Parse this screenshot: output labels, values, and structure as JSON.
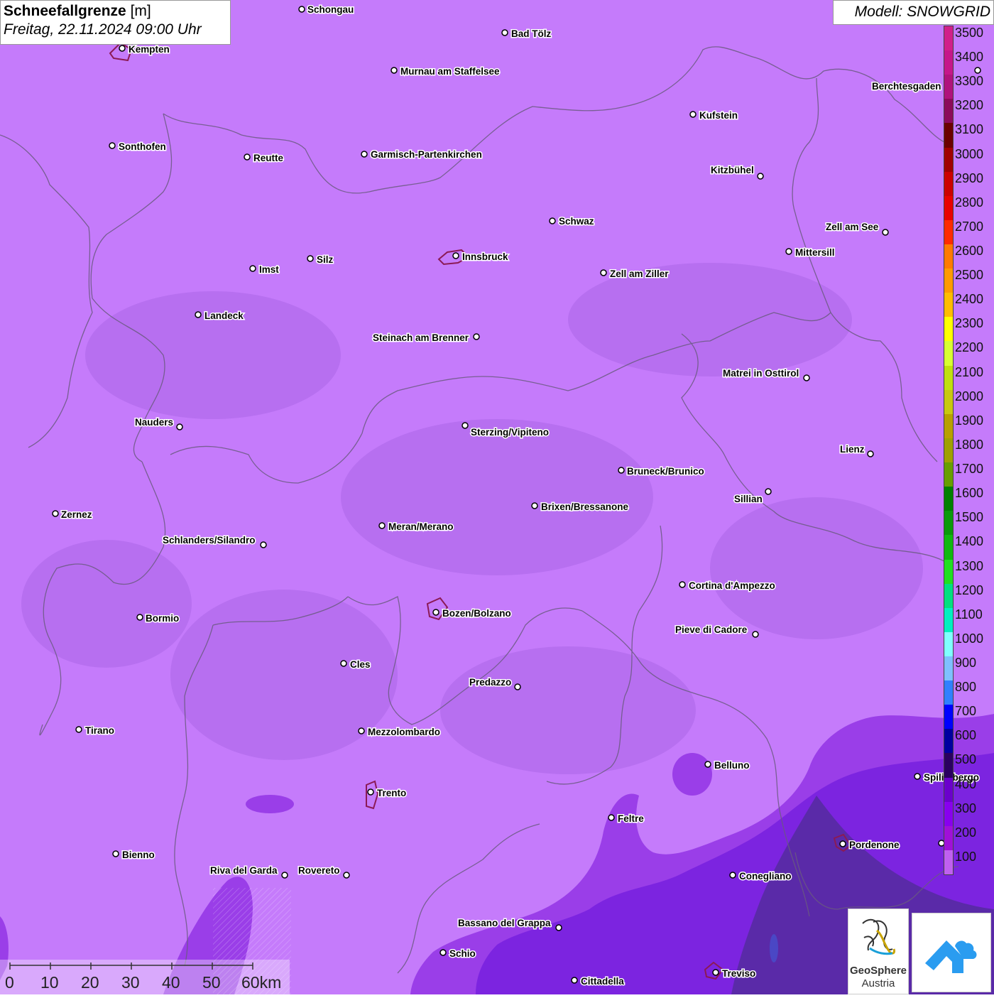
{
  "header": {
    "title": "Schneefallgrenze",
    "unit": "[m]",
    "datetime": "Freitag, 22.11.2024 09:00 Uhr"
  },
  "model": {
    "label": "Modell: SNOWGRID"
  },
  "colors": {
    "background": "#c57bfb",
    "low_band_300_400": "#9a3ee8",
    "low_band_100_200": "#7c24e0",
    "dark_band": "#5a2aa8",
    "boundary": "#6a5a80",
    "city_outline": "#8b1a55"
  },
  "legend": {
    "levels": [
      {
        "label": "3500",
        "color": "#d11f8a"
      },
      {
        "label": "3400",
        "color": "#c6168a"
      },
      {
        "label": "3300",
        "color": "#b0127c"
      },
      {
        "label": "3200",
        "color": "#8c0a5a"
      },
      {
        "label": "3100",
        "color": "#6b0000"
      },
      {
        "label": "3000",
        "color": "#a00000"
      },
      {
        "label": "2900",
        "color": "#cc0000"
      },
      {
        "label": "2800",
        "color": "#e80000"
      },
      {
        "label": "2700",
        "color": "#ff2a00"
      },
      {
        "label": "2600",
        "color": "#ff7a00"
      },
      {
        "label": "2500",
        "color": "#ff9a00"
      },
      {
        "label": "2400",
        "color": "#ffbc00"
      },
      {
        "label": "2300",
        "color": "#ffff00"
      },
      {
        "label": "2200",
        "color": "#d8ff33"
      },
      {
        "label": "2100",
        "color": "#c0e010"
      },
      {
        "label": "2000",
        "color": "#c8c810"
      },
      {
        "label": "1900",
        "color": "#b8a000"
      },
      {
        "label": "1800",
        "color": "#a0a000"
      },
      {
        "label": "1700",
        "color": "#689e00"
      },
      {
        "label": "1600",
        "color": "#008000"
      },
      {
        "label": "1500",
        "color": "#0a9a0a"
      },
      {
        "label": "1400",
        "color": "#10b810"
      },
      {
        "label": "1300",
        "color": "#20e020"
      },
      {
        "label": "1200",
        "color": "#00e080"
      },
      {
        "label": "1100",
        "color": "#00f0c0"
      },
      {
        "label": "1000",
        "color": "#80ffff"
      },
      {
        "label": "900",
        "color": "#7fc0ff"
      },
      {
        "label": "800",
        "color": "#3080ff"
      },
      {
        "label": "700",
        "color": "#0000ff"
      },
      {
        "label": "600",
        "color": "#0000a0"
      },
      {
        "label": "500",
        "color": "#2a0060"
      },
      {
        "label": "400",
        "color": "#6b00cc"
      },
      {
        "label": "300",
        "color": "#8800ee"
      },
      {
        "label": "200",
        "color": "#a010d8"
      },
      {
        "label": "100",
        "color": "#c060f0"
      }
    ]
  },
  "cities": [
    {
      "name": "Schongau"
    },
    {
      "name": "Kempten"
    },
    {
      "name": "Bad Tölz"
    },
    {
      "name": "Murnau am Staffelsee"
    },
    {
      "name": "Berchtesgaden"
    },
    {
      "name": "Kufstein"
    },
    {
      "name": "Sonthofen"
    },
    {
      "name": "Reutte"
    },
    {
      "name": "Garmisch-Partenkirchen"
    },
    {
      "name": "Kitzbühel"
    },
    {
      "name": "Schwaz"
    },
    {
      "name": "Zell am See"
    },
    {
      "name": "Innsbruck"
    },
    {
      "name": "Mittersill"
    },
    {
      "name": "Imst"
    },
    {
      "name": "Silz"
    },
    {
      "name": "Zell am Ziller"
    },
    {
      "name": "Landeck"
    },
    {
      "name": "Steinach am Brenner"
    },
    {
      "name": "Matrei in Osttirol"
    },
    {
      "name": "Nauders"
    },
    {
      "name": "Sterzing/Vipiteno"
    },
    {
      "name": "Lienz"
    },
    {
      "name": "Bruneck/Brunico"
    },
    {
      "name": "Sillian"
    },
    {
      "name": "Zernez"
    },
    {
      "name": "Brixen/Bressanone"
    },
    {
      "name": "Meran/Merano"
    },
    {
      "name": "Schlanders/Silandro"
    },
    {
      "name": "Cortina d'Ampezzo"
    },
    {
      "name": "Bozen/Bolzano"
    },
    {
      "name": "Bormio"
    },
    {
      "name": "Pieve di Cadore"
    },
    {
      "name": "Cles"
    },
    {
      "name": "Predazzo"
    },
    {
      "name": "Tirano"
    },
    {
      "name": "Mezzolombardo"
    },
    {
      "name": "Belluno"
    },
    {
      "name": "Spilimbergo"
    },
    {
      "name": "Trento"
    },
    {
      "name": "Feltre"
    },
    {
      "name": "Pordenone"
    },
    {
      "name": "Bienno"
    },
    {
      "name": "Riva del Garda"
    },
    {
      "name": "Rovereto"
    },
    {
      "name": "Conegliano"
    },
    {
      "name": "Bassano del Grappa"
    },
    {
      "name": "Schio"
    },
    {
      "name": "Treviso"
    },
    {
      "name": "Cittadella"
    }
  ],
  "scale": {
    "ticks": [
      "0",
      "10",
      "20",
      "30",
      "40",
      "50",
      "60km"
    ]
  },
  "logos": {
    "geosphere_line1": "GeoSphere",
    "geosphere_line2": "Austria"
  }
}
